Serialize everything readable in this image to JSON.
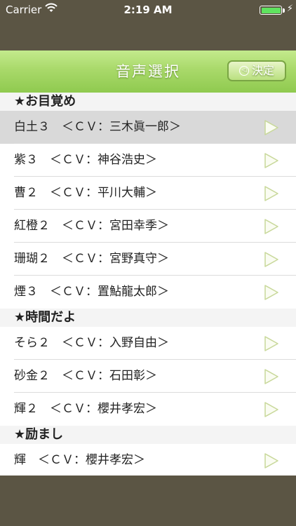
{
  "status": {
    "carrier": "Carrier",
    "time": "2:19 AM"
  },
  "nav": {
    "title": "音声選択",
    "decide_icon": "◁",
    "decide_label": "決定"
  },
  "sections": [
    {
      "title": "★お目覚め",
      "rows": [
        "白土３　＜ＣＶ：三木眞一郎＞",
        "紫３　＜ＣＶ：神谷浩史＞",
        "曹２　＜ＣＶ：平川大輔＞",
        "紅橙２　＜ＣＶ：宮田幸季＞",
        "珊瑚２　＜ＣＶ：宮野真守＞",
        "煙３　＜ＣＶ：置鮎龍太郎＞"
      ]
    },
    {
      "title": "★時間だよ",
      "rows": [
        "そら２　＜ＣＶ：入野自由＞",
        "砂金２　＜ＣＶ：石田彰＞",
        "輝２　＜ＣＶ：櫻井孝宏＞"
      ]
    },
    {
      "title": "★励まし",
      "rows": [
        "輝　＜ＣＶ：櫻井孝宏＞"
      ]
    }
  ],
  "colors": {
    "nav_green": "#a9d96a",
    "play_outline": "#c8d89a",
    "selected_row": "#d9d9d9"
  },
  "icons": {
    "wifi": "wifi-icon",
    "battery": "battery-icon",
    "charging": "bolt-icon",
    "play": "play-icon"
  }
}
